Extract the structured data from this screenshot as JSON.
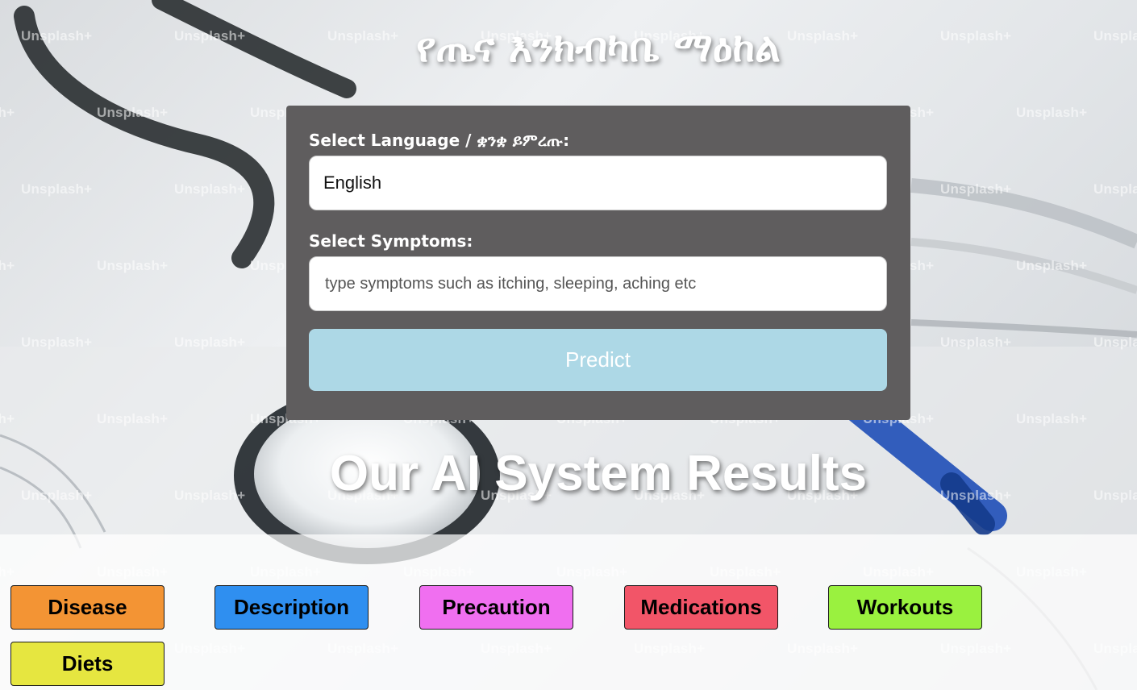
{
  "header": {
    "title": "የጤና እንክብካቤ ማዕከል"
  },
  "form": {
    "language_label": "Select Language / ቋንቋ ይምረጡ:",
    "language_value": "English",
    "symptoms_label": "Select Symptoms:",
    "symptoms_placeholder": "type symptoms such as itching, sleeping, aching etc",
    "predict_label": "Predict",
    "predict_color": "#add8e6",
    "card_color": "#5f5d5e"
  },
  "results": {
    "heading": "Our AI System Results",
    "buttons": [
      {
        "label": "Disease",
        "color": "#f39434"
      },
      {
        "label": "Description",
        "color": "#2f8ff0"
      },
      {
        "label": "Precaution",
        "color": "#f06ff0"
      },
      {
        "label": "Medications",
        "color": "#f25568"
      },
      {
        "label": "Workouts",
        "color": "#9af13f"
      },
      {
        "label": "Diets",
        "color": "#e6e640"
      }
    ]
  },
  "background": {
    "watermark_text": "Unsplash+"
  }
}
